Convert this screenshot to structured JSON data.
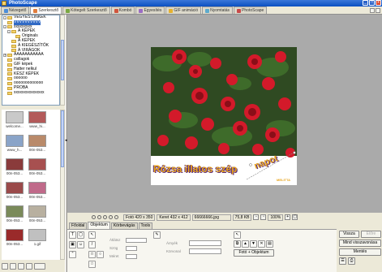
{
  "app": {
    "title": "PhotoScape"
  },
  "tabs": [
    {
      "label": "Nézegető",
      "color": "#4c8ed9"
    },
    {
      "label": "Szerkesztő",
      "color": "#e07c3c",
      "active": true
    },
    {
      "label": "Kötegelt Szerkesztő",
      "color": "#7aa843"
    },
    {
      "label": "Kombó",
      "color": "#d0553d"
    },
    {
      "label": "Egyesítés",
      "color": "#9a6cc4"
    },
    {
      "label": "GIF animáció",
      "color": "#e6b12e"
    },
    {
      "label": "Nyomtatás",
      "color": "#5caacd"
    },
    {
      "label": "PhotoScape",
      "color": "#c84a4a"
    }
  ],
  "tree": [
    {
      "label": "VEGYES LINKEK",
      "depth": 0,
      "exp": "-"
    },
    {
      "label": "VVVVVVVVVV",
      "depth": 0,
      "exp": "",
      "selected": true
    },
    {
      "label": "xxxxxxxxx",
      "depth": 0,
      "exp": "-"
    },
    {
      "label": "Á KÉPEK",
      "depth": 1,
      "exp": "-"
    },
    {
      "label": "Originals",
      "depth": 2,
      "exp": ""
    },
    {
      "label": "Á KÉPEK",
      "depth": 1,
      "exp": ""
    },
    {
      "label": "Á KIEGÉSZÍTŐK",
      "depth": 1,
      "exp": ""
    },
    {
      "label": "Á VIRÁGOK",
      "depth": 1,
      "exp": ""
    },
    {
      "label": "AAAAAAAAAAA",
      "depth": 0,
      "exp": "+"
    },
    {
      "label": "csillagok",
      "depth": 0,
      "exp": ""
    },
    {
      "label": "GIF képek",
      "depth": 0,
      "exp": ""
    },
    {
      "label": "Hatter nelkul",
      "depth": 0,
      "exp": ""
    },
    {
      "label": "KÉSZ KÉPEK",
      "depth": 0,
      "exp": ""
    },
    {
      "label": "oooooo",
      "depth": 0,
      "exp": ""
    },
    {
      "label": "ooooooooooooo",
      "depth": 0,
      "exp": ""
    },
    {
      "label": "PROBA",
      "depth": 0,
      "exp": ""
    },
    {
      "label": "xxxxxxxxxxxxxxx",
      "depth": 0,
      "exp": ""
    }
  ],
  "thumbnails": [
    {
      "caption": "welcome...",
      "color": "#c9c9c9"
    },
    {
      "caption": "www_hi...",
      "color": "#b35a5a"
    },
    {
      "caption": "www_h...",
      "color": "#8aa4c8"
    },
    {
      "caption": "00n-053...",
      "color": "#b98a6a"
    },
    {
      "caption": "00n-053...",
      "color": "#8a3b3b"
    },
    {
      "caption": "00n-053...",
      "color": "#a75050"
    },
    {
      "caption": "00n-053...",
      "color": "#9a4a4a"
    },
    {
      "caption": "00n-053...",
      "color": "#c06a8a"
    },
    {
      "caption": "00n-053...",
      "color": "#7a8a5a"
    },
    {
      "caption": "00n-053...",
      "color": "#b8b0a0"
    },
    {
      "caption": "00n-053...",
      "color": "#9a2a2a"
    },
    {
      "caption": "1.gif",
      "color": "#c0c0c0"
    }
  ],
  "canvas": {
    "photo_text": "Rózsa  illatos szép",
    "photo_text2": "napot",
    "watermark": "MELITTA"
  },
  "status": {
    "photo_size": "Fotó 420 x 350",
    "frame_size": "Keret 432 x 412",
    "filename": "66666666.jpg",
    "file_size": "75,8 KB",
    "zoom": "100%"
  },
  "edit_tabs": [
    {
      "label": "Főoldal"
    },
    {
      "label": "Objektum",
      "active": true
    },
    {
      "label": "Körbevágás"
    },
    {
      "label": "Tools"
    }
  ],
  "panel": {
    "photo_object_btn": "Fotó + Objektum",
    "opacity_label": "Átlátsz",
    "angle_label": "Szög",
    "size_label": "Méret",
    "shadow_label": "Árnyék",
    "outline_label": "Körvonal"
  },
  "right_buttons": [
    {
      "label": "Vissza",
      "disabled": false
    },
    {
      "label": "Előre",
      "disabled": true
    },
    {
      "label": "Mind visszavonása",
      "disabled": false,
      "full": true
    },
    {
      "label": "Mentés",
      "disabled": false,
      "full": true
    }
  ]
}
